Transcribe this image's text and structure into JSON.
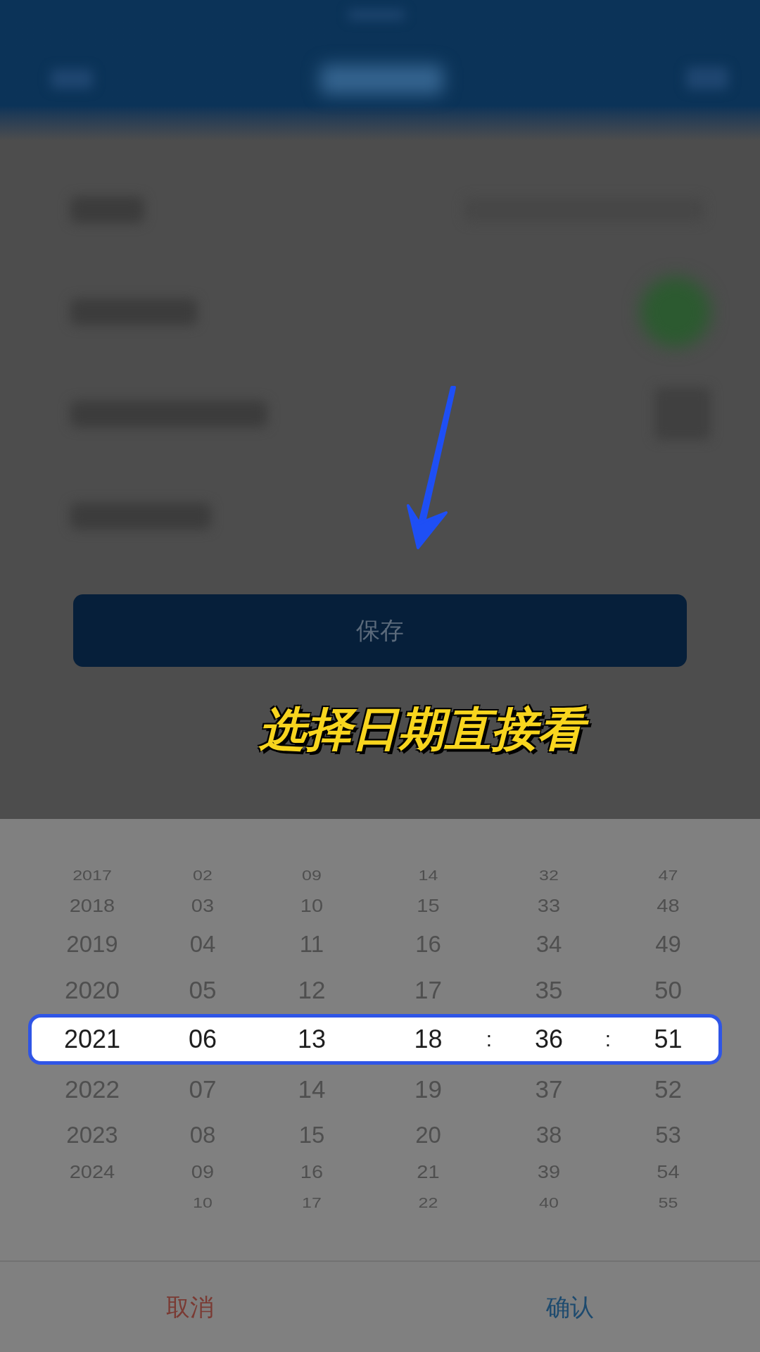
{
  "save_button": {
    "label": "保存"
  },
  "annotation": {
    "text": "选择日期直接看"
  },
  "date_picker": {
    "wheels": [
      {
        "kind": "wheel",
        "items": [
          {
            "text": "2017",
            "selected": false
          },
          {
            "text": "2018",
            "selected": false
          },
          {
            "text": "2019",
            "selected": false
          },
          {
            "text": "2020",
            "selected": false
          },
          {
            "text": "2021",
            "selected": true
          },
          {
            "text": "2022",
            "selected": false
          },
          {
            "text": "2023",
            "selected": false
          },
          {
            "text": "2024",
            "selected": false
          }
        ]
      },
      {
        "kind": "wheel",
        "items": [
          {
            "text": "02",
            "selected": false
          },
          {
            "text": "03",
            "selected": false
          },
          {
            "text": "04",
            "selected": false
          },
          {
            "text": "05",
            "selected": false
          },
          {
            "text": "06",
            "selected": true
          },
          {
            "text": "07",
            "selected": false
          },
          {
            "text": "08",
            "selected": false
          },
          {
            "text": "09",
            "selected": false
          },
          {
            "text": "10",
            "selected": false
          }
        ]
      },
      {
        "kind": "wheel",
        "items": [
          {
            "text": "09",
            "selected": false
          },
          {
            "text": "10",
            "selected": false
          },
          {
            "text": "11",
            "selected": false
          },
          {
            "text": "12",
            "selected": false
          },
          {
            "text": "13",
            "selected": true
          },
          {
            "text": "14",
            "selected": false
          },
          {
            "text": "15",
            "selected": false
          },
          {
            "text": "16",
            "selected": false
          },
          {
            "text": "17",
            "selected": false
          }
        ]
      },
      {
        "kind": "wheel",
        "items": [
          {
            "text": "14",
            "selected": false
          },
          {
            "text": "15",
            "selected": false
          },
          {
            "text": "16",
            "selected": false
          },
          {
            "text": "17",
            "selected": false
          },
          {
            "text": "18",
            "selected": true
          },
          {
            "text": "19",
            "selected": false
          },
          {
            "text": "20",
            "selected": false
          },
          {
            "text": "21",
            "selected": false
          },
          {
            "text": "22",
            "selected": false
          }
        ]
      },
      {
        "kind": "separator",
        "text": ":"
      },
      {
        "kind": "wheel",
        "items": [
          {
            "text": "32",
            "selected": false
          },
          {
            "text": "33",
            "selected": false
          },
          {
            "text": "34",
            "selected": false
          },
          {
            "text": "35",
            "selected": false
          },
          {
            "text": "36",
            "selected": true
          },
          {
            "text": "37",
            "selected": false
          },
          {
            "text": "38",
            "selected": false
          },
          {
            "text": "39",
            "selected": false
          },
          {
            "text": "40",
            "selected": false
          }
        ]
      },
      {
        "kind": "separator",
        "text": ":"
      },
      {
        "kind": "wheel",
        "items": [
          {
            "text": "47",
            "selected": false
          },
          {
            "text": "48",
            "selected": false
          },
          {
            "text": "49",
            "selected": false
          },
          {
            "text": "50",
            "selected": false
          },
          {
            "text": "51",
            "selected": true
          },
          {
            "text": "52",
            "selected": false
          },
          {
            "text": "53",
            "selected": false
          },
          {
            "text": "54",
            "selected": false
          },
          {
            "text": "55",
            "selected": false
          }
        ]
      }
    ],
    "buttons": [
      {
        "kind": "cancel",
        "label": "取消"
      },
      {
        "kind": "confirm",
        "label": "确认"
      }
    ]
  }
}
